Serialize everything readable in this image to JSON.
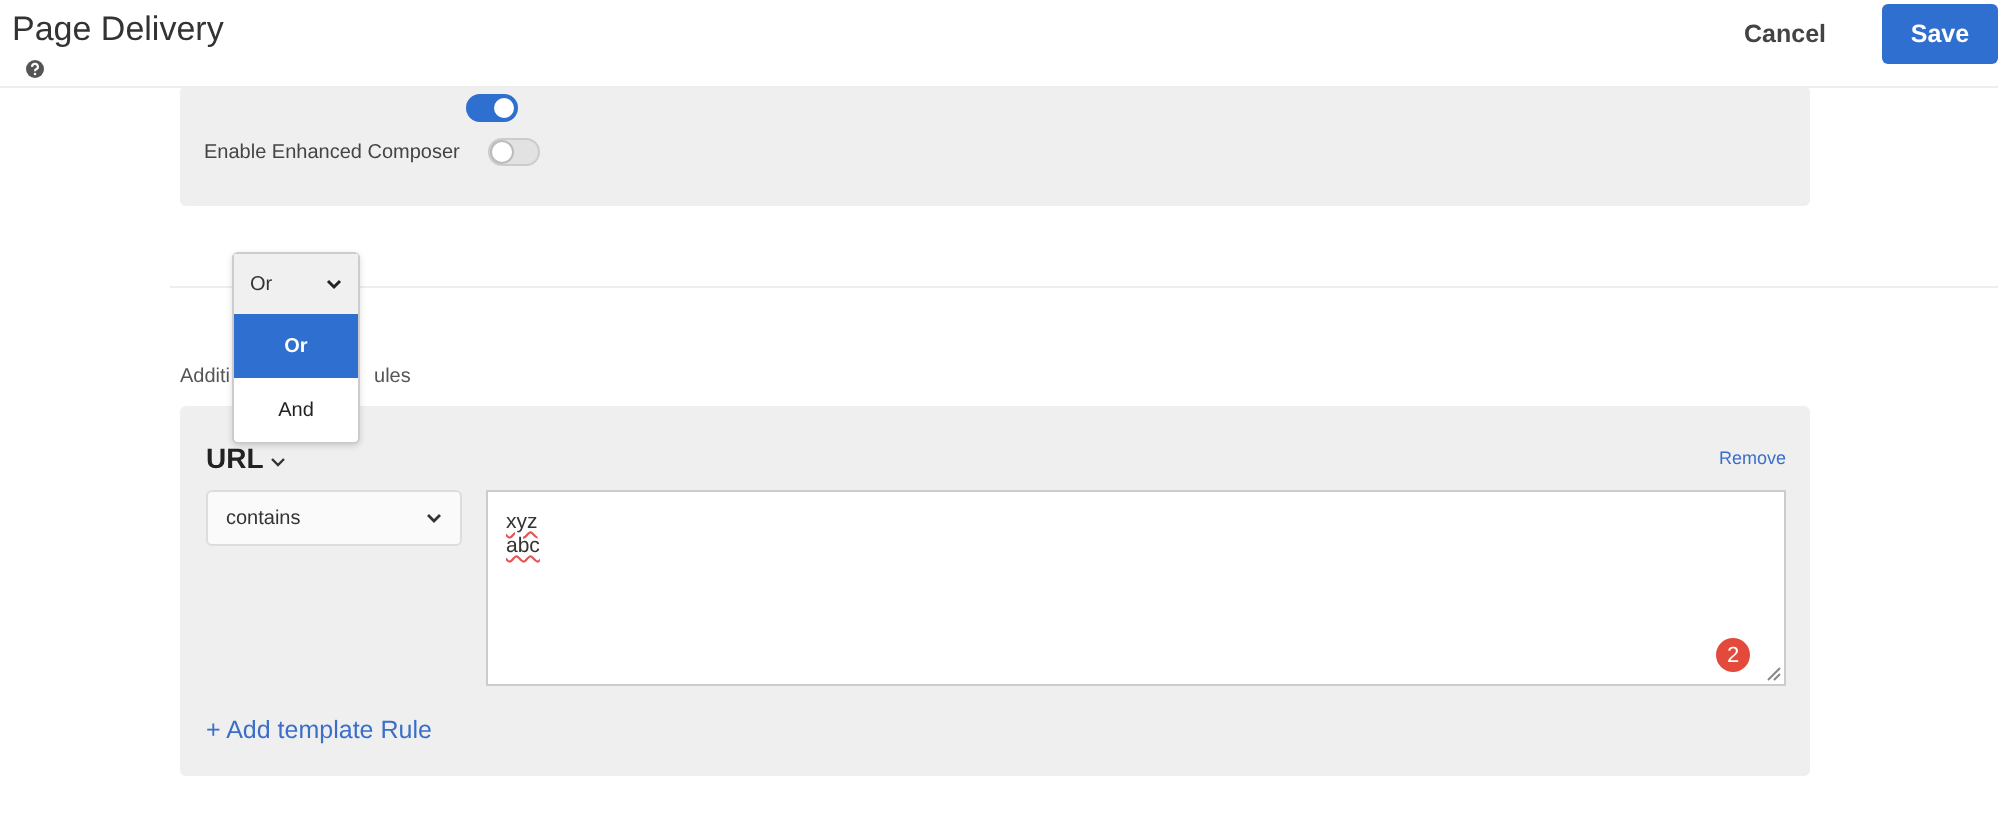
{
  "header": {
    "title": "Page Delivery",
    "buttons": [
      {
        "label": "Cancel",
        "kind": "quiet"
      },
      {
        "label": "Save",
        "kind": "primary"
      }
    ]
  },
  "settings": [
    {
      "on": true
    },
    {
      "label": "Enable Enhanced Composer",
      "on": false
    }
  ],
  "operator_dropdown": {
    "value": "Or",
    "options": [
      {
        "label": "Or",
        "selected": true
      },
      {
        "label": "And",
        "selected": false
      }
    ]
  },
  "rules_label": {
    "visible_start": "Additi",
    "visible_end": "ules"
  },
  "rule": {
    "field": "URL",
    "remove": "Remove",
    "condition": "contains",
    "values": [
      "xyz",
      "abc"
    ],
    "badge": "2"
  },
  "add_rule": "+ Add template Rule"
}
